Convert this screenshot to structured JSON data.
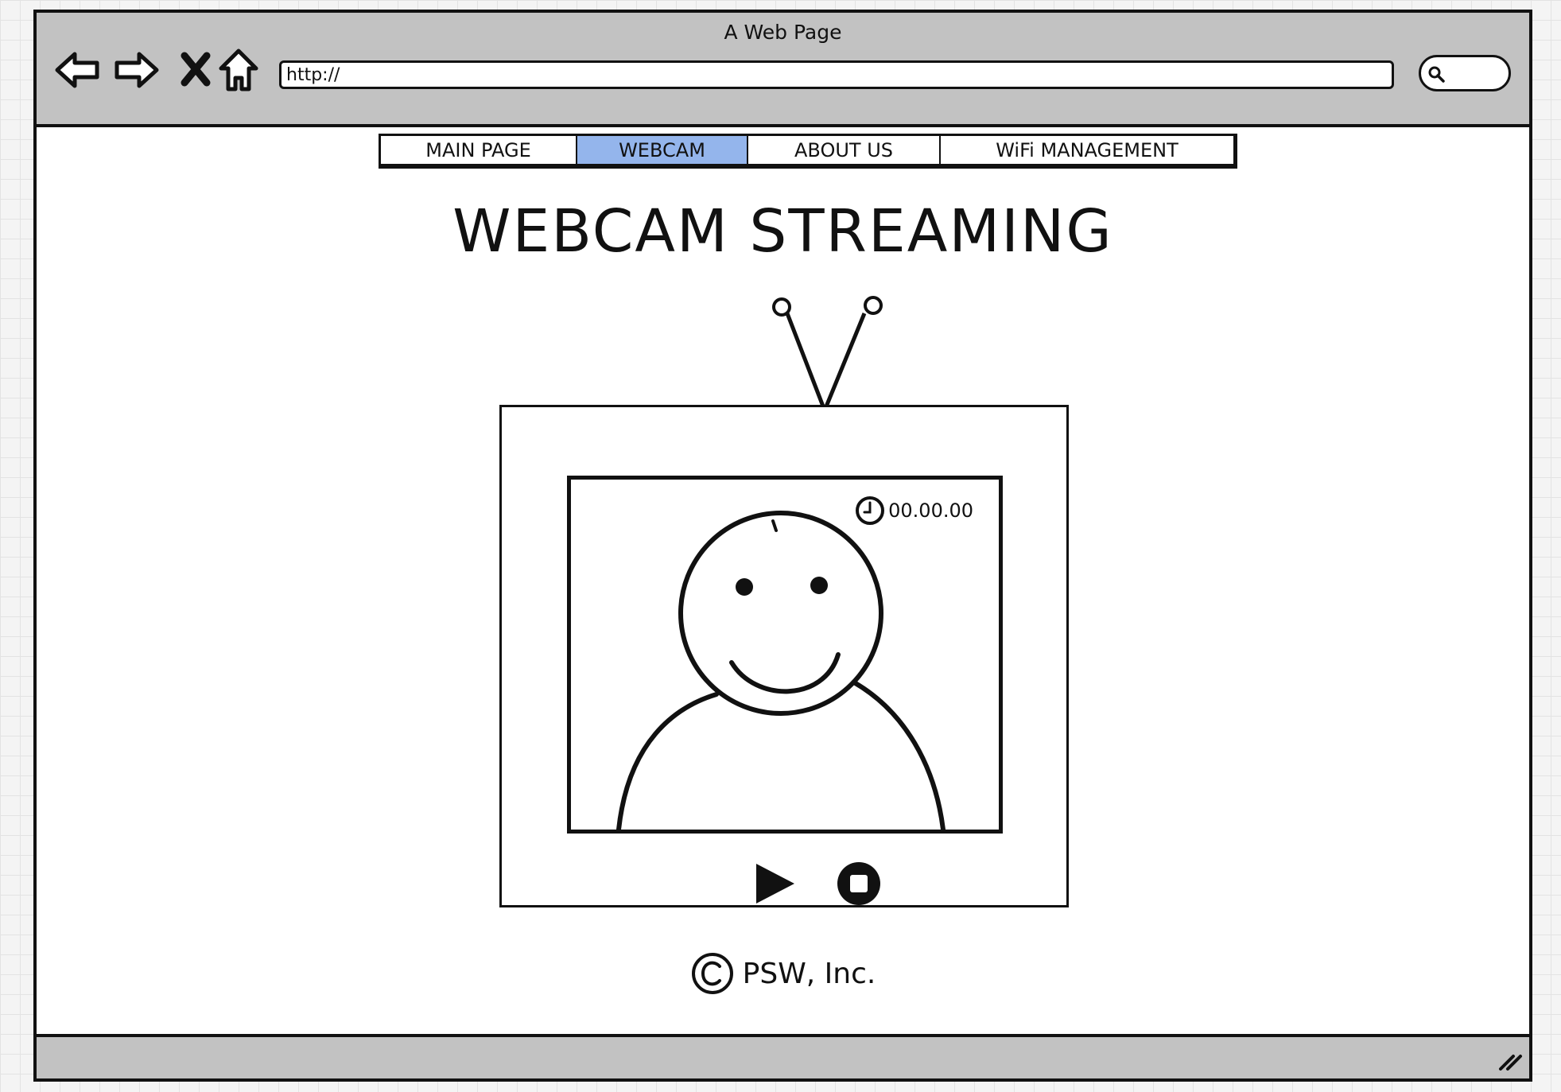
{
  "browser": {
    "title": "A Web Page",
    "url": "http://",
    "icons": {
      "back": "back-arrow-icon",
      "forward": "forward-arrow-icon",
      "stop": "close-x-icon",
      "home": "home-icon",
      "search": "search-icon"
    }
  },
  "nav": {
    "tabs": [
      {
        "label": "MAIN PAGE",
        "active": false
      },
      {
        "label": "WEBCAM",
        "active": true
      },
      {
        "label": "ABOUT US",
        "active": false
      },
      {
        "label": "WiFi MANAGEMENT",
        "active": false
      }
    ],
    "active_color": "#94b5ec"
  },
  "main": {
    "title": "WEBCAM STREAMING",
    "player": {
      "timer": "00.00.00",
      "controls": [
        "play-icon",
        "stop-icon"
      ]
    },
    "footer": {
      "copyright": "PSW, Inc."
    }
  }
}
